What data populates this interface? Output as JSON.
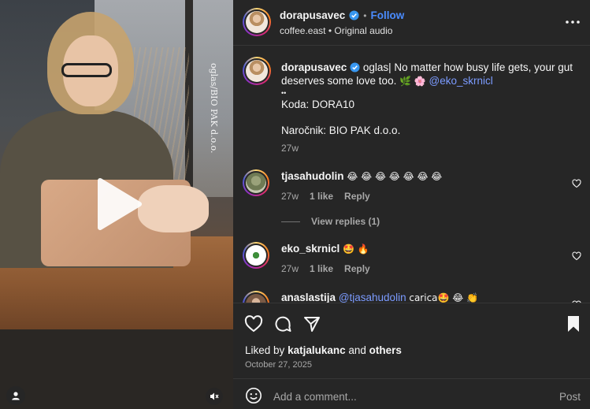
{
  "video": {
    "overlay_text": "oglas/BIO PAK d.o.o.",
    "icons": {
      "play": "play-icon",
      "profile": "person-icon",
      "mute": "speaker-muted-icon"
    }
  },
  "header": {
    "username": "dorapusavec",
    "separator": "•",
    "follow_label": "Follow",
    "location": "coffee.east",
    "audio_separator": "•",
    "audio": "Original audio"
  },
  "caption": {
    "username": "dorapusavec",
    "text_line1": "oglas| No matter how busy life gets, your gut",
    "text_line2_start": "deserves some love too.",
    "emoji_1": "🌿",
    "emoji_2": "🌸",
    "mention": "@eko_skrnicl",
    "dots": "••",
    "code": "Koda: DORA10",
    "client": "Naročnik: BIO PAK d.o.o.",
    "time": "27w"
  },
  "comments": [
    {
      "username": "tjasahudolin",
      "text": "😂 😂 😂 😂 😂 😂 😂",
      "time": "27w",
      "likes": "1 like",
      "reply": "Reply"
    },
    {
      "username": "eko_skrnicl",
      "text": "🤩 🔥",
      "time": "27w",
      "likes": "1 like",
      "reply": "Reply"
    },
    {
      "username": "anaslastija",
      "mention": "@tjasahudolin",
      "text": "carica🤩 😂 👏"
    }
  ],
  "view_replies": "View replies (1)",
  "actions": {
    "liked_by_prefix": "Liked by",
    "liked_by_user": "katjalukanc",
    "liked_by_and": "and",
    "liked_by_others": "others",
    "date": "October 27, 2025"
  },
  "add_comment": {
    "placeholder": "Add a comment...",
    "post_label": "Post"
  },
  "colors": {
    "panel_bg": "#262626",
    "link_blue": "#4a8cff",
    "mention_blue": "#7b9bff",
    "muted_text": "#a8a8a8"
  }
}
